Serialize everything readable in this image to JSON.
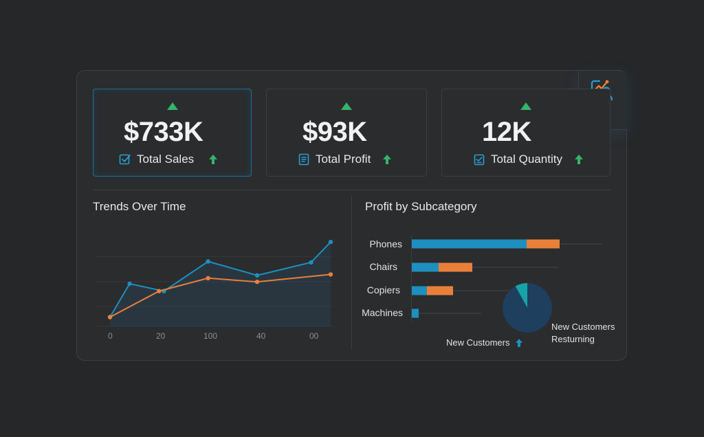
{
  "kpis": [
    {
      "value": "$733K",
      "label": "Total Sales",
      "trend": "up",
      "icon": "checklist-icon"
    },
    {
      "value": "$93K",
      "label": "Total Profit",
      "trend": "up",
      "icon": "document-icon"
    },
    {
      "value": "12K",
      "label": "Total Quantity",
      "trend": "up",
      "icon": "clipboard-icon"
    }
  ],
  "colors": {
    "accent_blue": "#1e8fbf",
    "accent_orange": "#e8803a",
    "up_green": "#35b46a",
    "pie_dark": "#1f3f5e",
    "pie_teal": "#16a3a8"
  },
  "trends": {
    "title": "Trends Over Time",
    "x_ticks": [
      "0",
      "20",
      "100",
      "40",
      "00"
    ]
  },
  "profit": {
    "title": "Profit by Subcategory",
    "categories": [
      "Phones",
      "Chairs",
      "Copiers",
      "Machines"
    ]
  },
  "pie": {
    "legend_new": "New Customers",
    "legend_returning_line1": "New Customers",
    "legend_returning_line2": "Resturning"
  },
  "chart_data": [
    {
      "type": "line",
      "title": "Trends Over Time",
      "x_tick_labels": [
        "0",
        "20",
        "100",
        "40",
        "00"
      ],
      "series": [
        {
          "color": "#1e8fbf",
          "values": [
            {
              "x": 0,
              "y": 10
            },
            {
              "x": 8,
              "y": 46
            },
            {
              "x": 22,
              "y": 38
            },
            {
              "x": 40,
              "y": 70
            },
            {
              "x": 60,
              "y": 55
            },
            {
              "x": 82,
              "y": 69
            },
            {
              "x": 90,
              "y": 91
            }
          ]
        },
        {
          "color": "#e8803a",
          "values": [
            {
              "x": 0,
              "y": 10
            },
            {
              "x": 20,
              "y": 38
            },
            {
              "x": 40,
              "y": 52
            },
            {
              "x": 60,
              "y": 48
            },
            {
              "x": 90,
              "y": 56
            }
          ]
        }
      ]
    },
    {
      "type": "bar",
      "title": "Profit by Subcategory",
      "orientation": "horizontal",
      "stacked": true,
      "categories": [
        "Phones",
        "Chairs",
        "Copiers",
        "Machines"
      ],
      "series": [
        {
          "color": "#1e8fbf",
          "values": [
            168,
            40,
            23,
            11
          ]
        },
        {
          "color": "#e8803a",
          "values": [
            48,
            49,
            38,
            0
          ]
        }
      ],
      "track_lengths": [
        278,
        214,
        142,
        102
      ]
    },
    {
      "type": "pie",
      "slices": [
        {
          "label": "New Customers",
          "value": 8,
          "color": "#16a3a8"
        },
        {
          "label": "Resturning",
          "value": 92,
          "color": "#1f3f5e"
        }
      ]
    }
  ]
}
